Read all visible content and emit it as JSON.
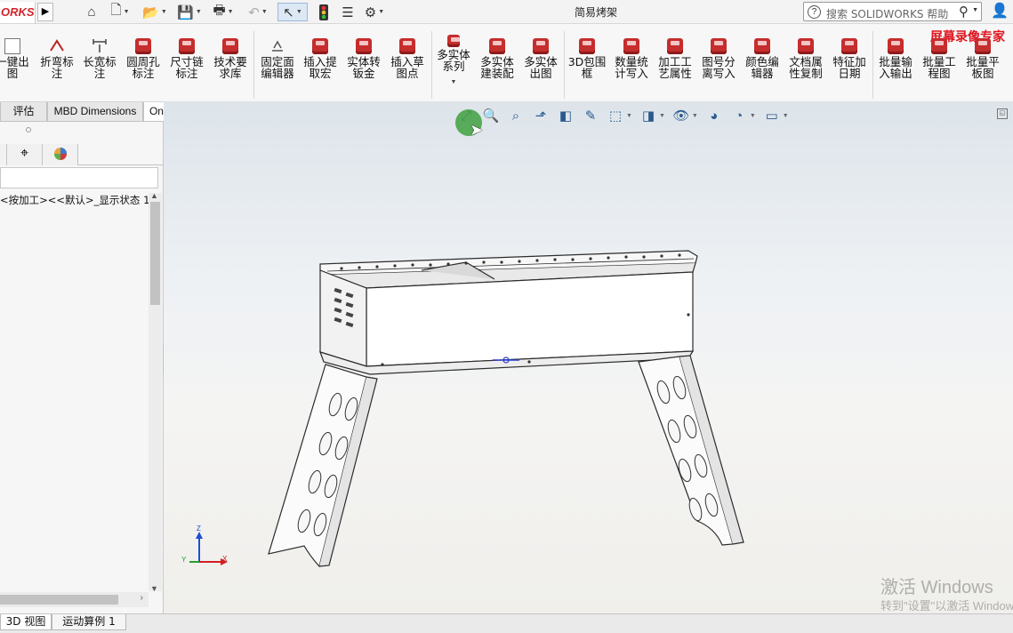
{
  "app": {
    "logo_text": "ORKS",
    "document_title": "简易烤架",
    "search_placeholder": "搜索 SOLIDWORKS 帮助",
    "promo_text": "屏幕录像专家"
  },
  "quick_access": [
    {
      "name": "home-icon",
      "glyph": "⌂"
    },
    {
      "name": "new-document-icon",
      "glyph": "🗋"
    },
    {
      "name": "open-folder-icon",
      "glyph": "📂"
    },
    {
      "name": "save-icon",
      "glyph": "💾"
    },
    {
      "name": "print-icon",
      "glyph": "🖶"
    },
    {
      "name": "undo-icon",
      "glyph": "↶"
    },
    {
      "name": "select-pointer-icon",
      "glyph": "↖"
    },
    {
      "name": "traffic-light-icon",
      "glyph": "🚦"
    },
    {
      "name": "file-properties-icon",
      "glyph": "☰"
    },
    {
      "name": "options-gear-icon",
      "glyph": "⚙"
    }
  ],
  "ribbon": {
    "buttons": [
      {
        "label": "一键出\n图",
        "icon": "document-icon"
      },
      {
        "label": "折弯标\n注",
        "icon": "bend-note-icon"
      },
      {
        "label": "长宽标\n注",
        "icon": "dimension-icon"
      },
      {
        "label": "圆周孔\n标注",
        "icon": "plugin-cube-icon"
      },
      {
        "label": "尺寸链\n标注",
        "icon": "plugin-cube-icon"
      },
      {
        "label": "技术要\n求库",
        "icon": "plugin-cube-icon"
      },
      {
        "label": "固定面\n编辑器",
        "icon": "fixed-face-icon"
      },
      {
        "label": "插入提\n取宏",
        "icon": "plugin-cube-icon"
      },
      {
        "label": "实体转\n钣金",
        "icon": "plugin-cube-icon"
      },
      {
        "label": "插入草\n图点",
        "icon": "plugin-cube-icon"
      },
      {
        "label": "多实体\n系列",
        "icon": "plugin-cube-icon"
      },
      {
        "label": "多实体\n建装配",
        "icon": "plugin-cube-icon"
      },
      {
        "label": "多实体\n出图",
        "icon": "plugin-cube-icon"
      },
      {
        "label": "3D包围\n框",
        "icon": "plugin-cube-icon"
      },
      {
        "label": "数量统\n计写入",
        "icon": "plugin-cube-icon"
      },
      {
        "label": "加工工\n艺属性",
        "icon": "plugin-cube-icon"
      },
      {
        "label": "图号分\n离写入",
        "icon": "plugin-cube-icon"
      },
      {
        "label": "颜色编\n辑器",
        "icon": "plugin-cube-icon"
      },
      {
        "label": "文档属\n性复制",
        "icon": "plugin-cube-icon"
      },
      {
        "label": "特征加\n日期",
        "icon": "plugin-cube-icon"
      },
      {
        "label": "批量输\n入输出",
        "icon": "plugin-cube-icon"
      },
      {
        "label": "批量工\n程图",
        "icon": "plugin-cube-icon"
      },
      {
        "label": "批量平\n板图",
        "icon": "plugin-cube-icon"
      }
    ]
  },
  "tabs": [
    "评估",
    "MBD Dimensions",
    "OnCadTools"
  ],
  "feature_manager": {
    "tree_item": "<按加工><<默认>_显示状态 1>"
  },
  "viewport": {
    "watermark_line1": "激活 Windows",
    "watermark_line2": "转到\"设置\"以激活 Windows"
  },
  "triad": {
    "x": "X",
    "y": "Y",
    "z": "Z"
  },
  "status_tabs": [
    "3D 视图",
    "运动算例 1"
  ],
  "colors": {
    "brand_red": "#d2232a",
    "promo_red": "#e0141e",
    "cursor_green": "#40a040",
    "part_outline": "#2b2b2b"
  }
}
